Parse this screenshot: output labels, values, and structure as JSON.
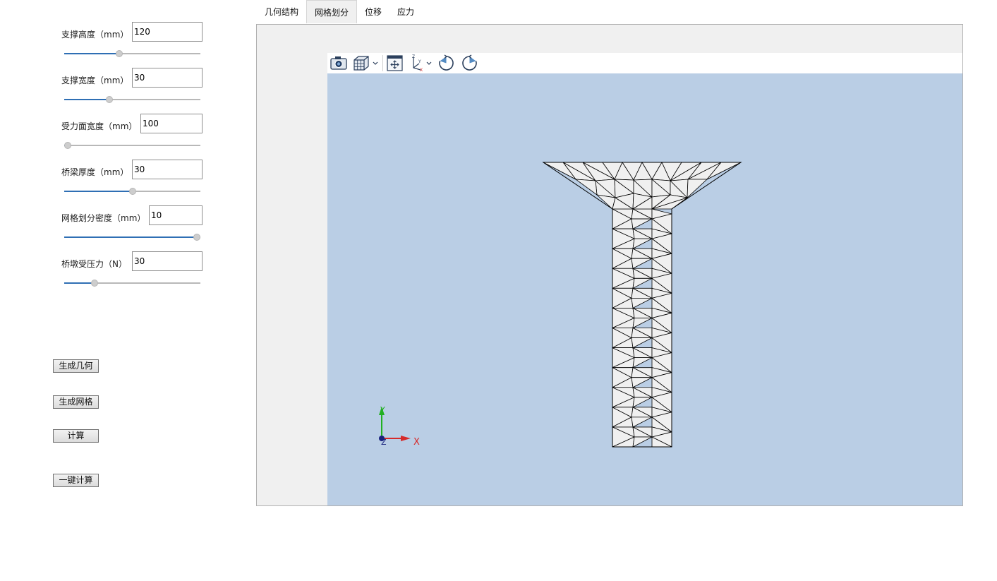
{
  "params": [
    {
      "label": "支撑高度（mm）",
      "value": "120",
      "slider_fraction": 0.4
    },
    {
      "label": "支撑宽度（mm）",
      "value": "30",
      "slider_fraction": 0.32
    },
    {
      "label": "受力面宽度（mm）",
      "value": "100",
      "slider_fraction": 0.0
    },
    {
      "label": "桥梁厚度（mm）",
      "value": "30",
      "slider_fraction": 0.5
    },
    {
      "label": "网格划分密度（mm）",
      "value": "10",
      "slider_fraction": 1.0
    },
    {
      "label": "桥墩受压力（N）",
      "value": "30",
      "slider_fraction": 0.21
    }
  ],
  "buttons": {
    "generate_geometry": "生成几何",
    "generate_mesh": "生成网格",
    "compute": "计算",
    "one_click_compute": "一键计算"
  },
  "tabs": [
    {
      "label": "几何结构",
      "active": false
    },
    {
      "label": "网格划分",
      "active": true
    },
    {
      "label": "位移",
      "active": false
    },
    {
      "label": "应力",
      "active": false
    }
  ],
  "toolbar_icons": [
    "camera-icon",
    "view-cube-icon",
    "dropdown-chevron-icon",
    "fit-view-icon",
    "axes-orientation-icon",
    "dropdown-chevron-icon",
    "rotate-clockwise-icon",
    "rotate-counterclockwise-icon"
  ],
  "axes": {
    "x": "X",
    "y": "Y",
    "z": "Z"
  },
  "colors": {
    "viewport_bg": "#bacee5",
    "mesh_fill": "#f0f0f0",
    "mesh_edge": "#000000",
    "slider_fill": "#2f6fb4",
    "axis_x": "#d62a2a",
    "axis_y": "#22b022",
    "axis_z": "#1a237e"
  }
}
